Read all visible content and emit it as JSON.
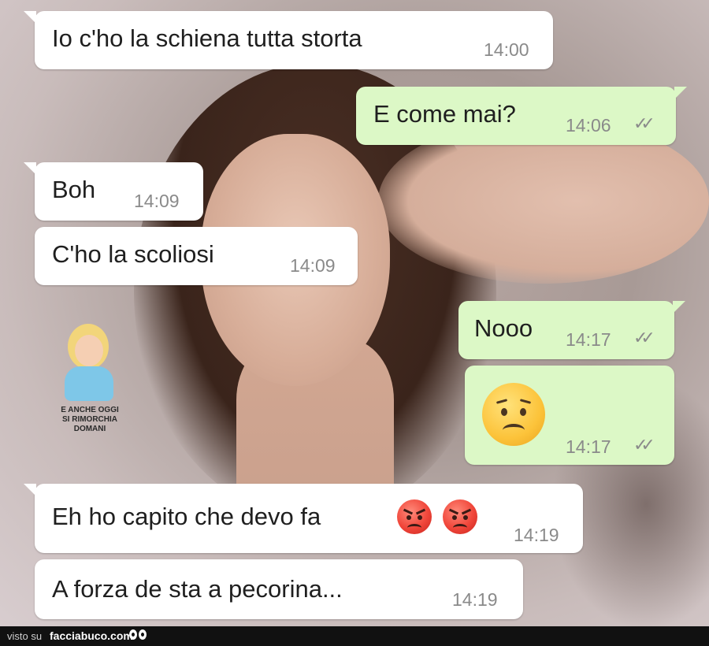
{
  "chat": {
    "messages": [
      {
        "text": "Io c'ho la schiena tutta storta",
        "time": "14:00"
      },
      {
        "text": "E come mai?",
        "time": "14:06"
      },
      {
        "text": "Boh",
        "time": "14:09"
      },
      {
        "text": "C'ho la scoliosi",
        "time": "14:09"
      },
      {
        "text": "Nooo",
        "time": "14:17"
      },
      {
        "emoji": "worried-face",
        "time": "14:17"
      },
      {
        "text": "Eh ho capito che devo fa",
        "emojis": [
          "angry-face",
          "angry-face"
        ],
        "time": "14:19"
      },
      {
        "text": "A forza de sta a pecorina...",
        "time": "14:19"
      }
    ],
    "colors": {
      "incoming": "#ffffff",
      "outgoing": "#dcf8c6",
      "time": "#8a8a8a"
    }
  },
  "sticker": {
    "caption_line1": "E ANCHE OGGI",
    "caption_line2": "SI RIMORCHIA DOMANI"
  },
  "footer": {
    "visto": "visto su",
    "site": "facciabuco.com"
  }
}
